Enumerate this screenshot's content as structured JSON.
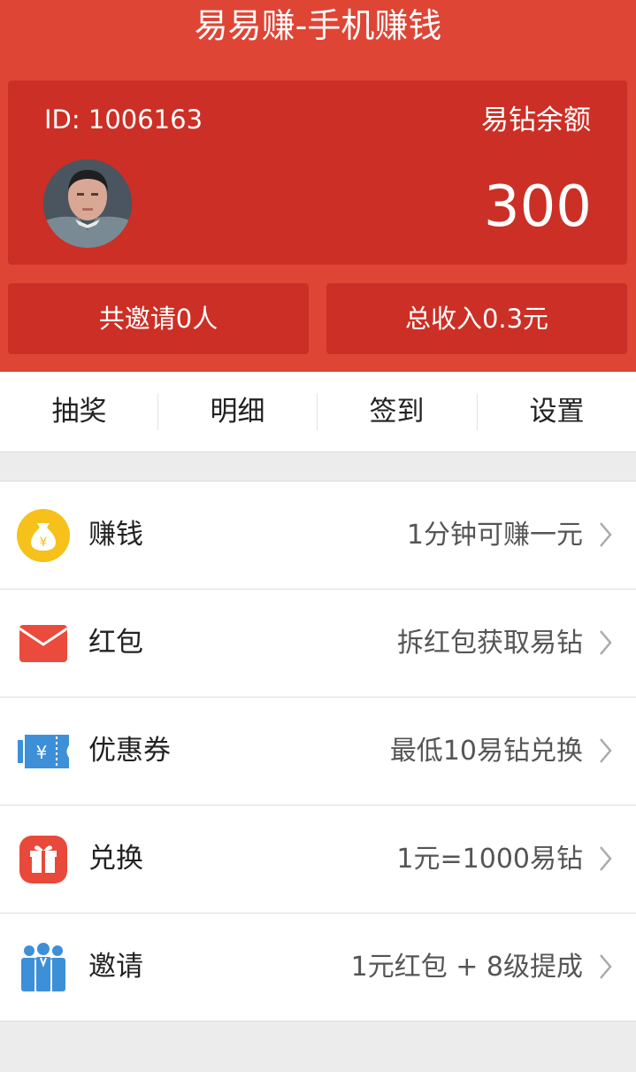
{
  "app": {
    "title": "易易赚-手机赚钱"
  },
  "account": {
    "id_text": "ID: 1006163",
    "balance_label": "易钻余额",
    "balance_value": "300",
    "invited_text": "共邀请0人",
    "income_text": "总收入0.3元"
  },
  "quick_nav": {
    "items": [
      {
        "label": "抽奖"
      },
      {
        "label": "明细"
      },
      {
        "label": "签到"
      },
      {
        "label": "设置"
      }
    ]
  },
  "menu": {
    "items": [
      {
        "label": "赚钱",
        "desc": "1分钟可赚一元",
        "icon": "money-bag-icon"
      },
      {
        "label": "红包",
        "desc": "拆红包获取易钻",
        "icon": "envelope-icon"
      },
      {
        "label": "优惠券",
        "desc": "最低10易钻兑换",
        "icon": "coupon-icon"
      },
      {
        "label": "兑换",
        "desc": "1元=1000易钻",
        "icon": "gift-icon"
      },
      {
        "label": "邀请",
        "desc": "1元红包 + 8级提成",
        "icon": "people-icon"
      }
    ]
  },
  "colors": {
    "header": "#de4535",
    "card": "#cc2f25",
    "coin": "#f5c11a",
    "envelope": "#ea4b3c",
    "coupon": "#3d8fd8",
    "gift": "#e8493b",
    "people": "#3d8fd8"
  }
}
